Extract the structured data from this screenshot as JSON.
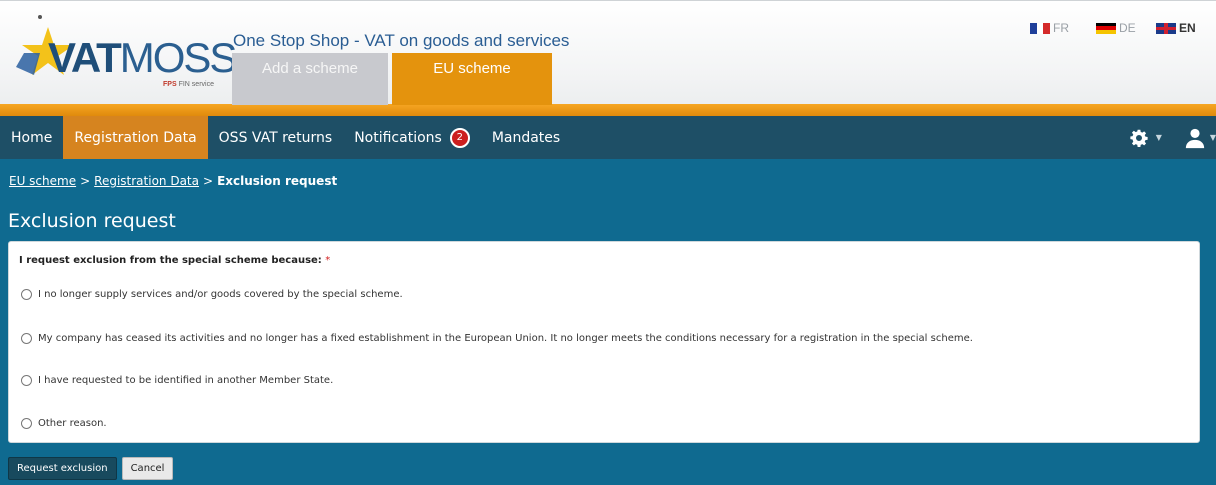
{
  "header": {
    "logo": {
      "main": "VAT",
      "secondary": "MOSS",
      "sub_brand": "FPS",
      "sub_text": "FIN service"
    },
    "tagline": "One Stop Shop - VAT on goods and services",
    "scheme_tabs": [
      {
        "label": "Add a scheme",
        "active": false
      },
      {
        "label": "EU scheme",
        "active": true
      }
    ],
    "languages": [
      {
        "code": "FR",
        "active": false
      },
      {
        "code": "DE",
        "active": false
      },
      {
        "code": "EN",
        "active": true
      }
    ]
  },
  "nav": {
    "items": [
      {
        "label": "Home"
      },
      {
        "label": "Registration Data",
        "active": true
      },
      {
        "label": "OSS VAT returns"
      },
      {
        "label": "Notifications",
        "badge": "2"
      },
      {
        "label": "Mandates"
      }
    ],
    "icons": [
      "gear-icon",
      "user-icon"
    ]
  },
  "breadcrumb": {
    "items": [
      "EU scheme",
      "Registration Data"
    ],
    "separator": ">",
    "current": "Exclusion request"
  },
  "page": {
    "title": "Exclusion request",
    "question": "I request exclusion from the special scheme because:",
    "required_marker": "*",
    "options": [
      "I no longer supply services and/or goods covered by the special scheme.",
      "My company has ceased its activities and no longer has a fixed establishment in the European Union. It no longer meets the conditions necessary for a registration in the special scheme.",
      "I have requested to be identified in another Member State.",
      "Other reason."
    ]
  },
  "actions": {
    "submit": "Request exclusion",
    "cancel": "Cancel"
  },
  "colors": {
    "nav_bg": "#1e4f66",
    "content_bg": "#0f6a90",
    "accent_orange": "#e4930d",
    "badge_red": "#cc1f1f"
  }
}
